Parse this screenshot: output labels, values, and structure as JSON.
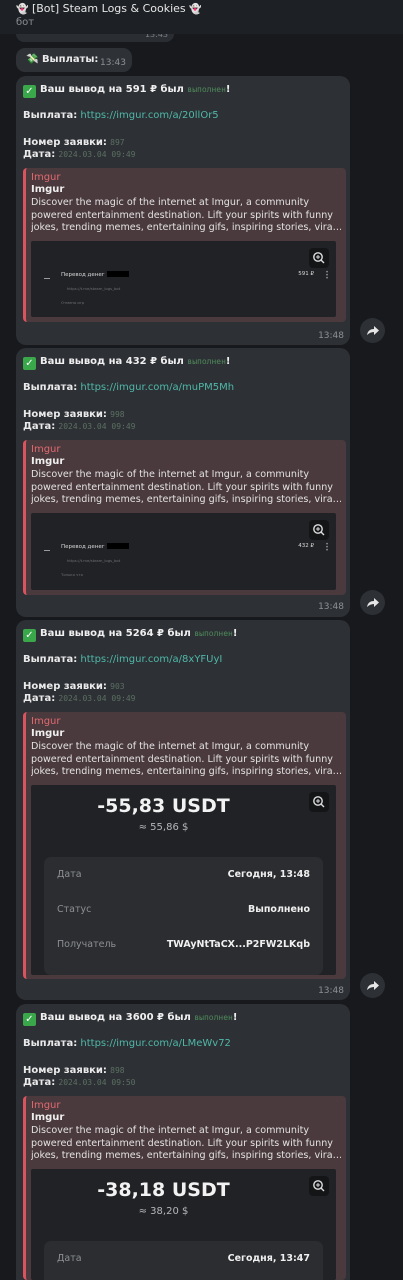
{
  "header": {
    "ghost_icon": "👻",
    "title": "[Bot] Steam Logs & Cookies",
    "subtitle": "бот"
  },
  "prev_message": {
    "time": "13:43"
  },
  "payouts_header": {
    "emoji": "💸",
    "label": "Выплаты:",
    "time": "13:43"
  },
  "messages": [
    {
      "title_prefix": "Ваш вывод на 591 ₽ был",
      "status": "выполнен",
      "excl": "!",
      "payout_label": "Выплата:",
      "payout_link": "https://imgur.com/a/20llOr5",
      "order_label": "Номер заявки:",
      "order_number": "897",
      "date_label": "Дата:",
      "date_value": "2024.03.04 09:49",
      "preview": {
        "site": "Imgur",
        "name": "Imgur",
        "desc_lines": [
          "Discover the magic of the internet at Imgur, a community",
          "powered entertainment destination. Lift your spirits with funny",
          "jokes, trending memes, entertaining gifs, inspiring stories, vira…"
        ],
        "transfer_label": "Перевод денег",
        "amount": "591 ₽",
        "url": "https://t.me/steam_logs_bot",
        "state": "Отмена игр"
      },
      "time": "13:48"
    },
    {
      "title_prefix": "Ваш вывод на 432 ₽ был",
      "status": "выполнен",
      "excl": "!",
      "payout_label": "Выплата:",
      "payout_link": "https://imgur.com/a/muPM5Mh",
      "order_label": "Номер заявки:",
      "order_number": "998",
      "date_label": "Дата:",
      "date_value": "2024.03.04 09:49",
      "preview": {
        "site": "Imgur",
        "name": "Imgur",
        "desc_lines": [
          "Discover the magic of the internet at Imgur, a community",
          "powered entertainment destination. Lift your spirits with funny",
          "jokes, trending memes, entertaining gifs, inspiring stories, vira…"
        ],
        "transfer_label": "Перевод денег",
        "amount": "432 ₽",
        "url": "https://t.me/steam_logs_bot",
        "state": "Только что"
      },
      "time": "13:48"
    },
    {
      "title_prefix": "Ваш вывод на 5264 ₽ был",
      "status": "выполнен",
      "excl": "!",
      "payout_label": "Выплата:",
      "payout_link": "https://imgur.com/a/8xYFUyI",
      "order_label": "Номер заявки:",
      "order_number": "903",
      "date_label": "Дата:",
      "date_value": "2024.03.04 09:49",
      "preview": {
        "site": "Imgur",
        "name": "Imgur",
        "desc_lines": [
          "Discover the magic of the internet at Imgur, a community",
          "powered entertainment destination. Lift your spirits with funny",
          "jokes, trending memes, entertaining gifs, inspiring stories, vira…"
        ],
        "usdt_amount": "-55,83 USDT",
        "usdt_approx": "≈ 55,86 $",
        "rows": [
          {
            "k": "Дата",
            "v": "Сегодня, 13:48"
          },
          {
            "k": "Статус",
            "v": "Выполнено"
          },
          {
            "k": "Получатель",
            "v": "TWAyNtTaCX...P2FW2LKqb"
          }
        ]
      },
      "time": "13:48"
    },
    {
      "title_prefix": "Ваш вывод на 3600 ₽ был",
      "status": "выполнен",
      "excl": "!",
      "payout_label": "Выплата:",
      "payout_link": "https://imgur.com/a/LMeWv72",
      "order_label": "Номер заявки:",
      "order_number": "898",
      "date_label": "Дата:",
      "date_value": "2024.03.04 09:50",
      "preview": {
        "site": "Imgur",
        "name": "Imgur",
        "desc_lines": [
          "Discover the magic of the internet at Imgur, a community",
          "powered entertainment destination. Lift your spirits with funny",
          "jokes, trending memes, entertaining gifs, inspiring stories, vira…"
        ],
        "usdt_amount": "-38,18 USDT",
        "usdt_approx": "≈ 38,20 $",
        "rows": [
          {
            "k": "Дата",
            "v": "Сегодня, 13:47"
          }
        ]
      }
    }
  ]
}
